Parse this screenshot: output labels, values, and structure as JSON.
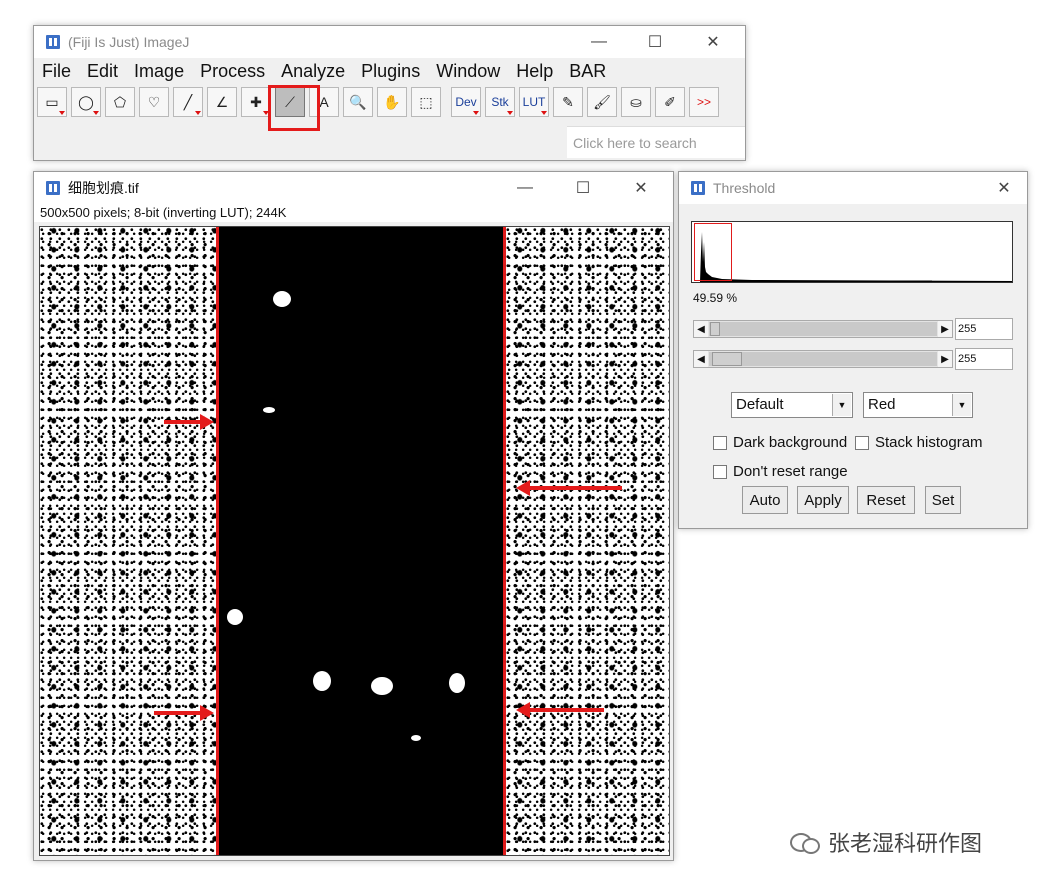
{
  "imagej": {
    "title": "(Fiji Is Just) ImageJ",
    "menus": [
      "File",
      "Edit",
      "Image",
      "Process",
      "Analyze",
      "Plugins",
      "Window",
      "Help",
      "BAR"
    ],
    "tools": [
      {
        "icon": "rectangle-tool-icon",
        "glyph": "▭"
      },
      {
        "icon": "oval-tool-icon",
        "glyph": "◯"
      },
      {
        "icon": "polygon-tool-icon",
        "glyph": "⬠"
      },
      {
        "icon": "freehand-tool-icon",
        "glyph": "♡"
      },
      {
        "icon": "line-tool-icon",
        "glyph": "╱"
      },
      {
        "icon": "angle-tool-icon",
        "glyph": "∠"
      },
      {
        "icon": "point-tool-icon",
        "glyph": "✚"
      },
      {
        "icon": "wand-tool-icon",
        "glyph": "⟋"
      },
      {
        "icon": "text-tool-icon",
        "glyph": "A"
      },
      {
        "icon": "magnifier-tool-icon",
        "glyph": "🔍"
      },
      {
        "icon": "scroll-hand-tool-icon",
        "glyph": "✋"
      },
      {
        "icon": "color-picker-tool-icon",
        "glyph": "⬚"
      }
    ],
    "menu_tools": [
      "Dev",
      "Stk",
      "LUT"
    ],
    "extra_tools": [
      {
        "icon": "pencil-tool-icon",
        "glyph": "✎"
      },
      {
        "icon": "brush-tool-icon",
        "glyph": "🖌"
      },
      {
        "icon": "flood-fill-tool-icon",
        "glyph": "⛀"
      },
      {
        "icon": "dropper-tool-icon",
        "glyph": "✐"
      },
      {
        "icon": "more-tools-icon",
        "glyph": ">>"
      }
    ],
    "search_placeholder": "Click here to search"
  },
  "image_window": {
    "title": "细胞划痕.tif",
    "info": "500x500 pixels; 8-bit (inverting LUT); 244K"
  },
  "threshold": {
    "title": "Threshold",
    "percent": "49.59 %",
    "slider1_value": "255",
    "slider2_value": "255",
    "method": "Default",
    "display": "Red",
    "dark_background": "Dark background",
    "stack_histogram": "Stack histogram",
    "dont_reset": "Don't reset range",
    "buttons": [
      "Auto",
      "Apply",
      "Reset",
      "Set"
    ]
  },
  "watermark": "张老湿科研作图",
  "colors": {
    "annotation_red": "#e41b1b",
    "brand_blue": "#3b6fc6"
  }
}
